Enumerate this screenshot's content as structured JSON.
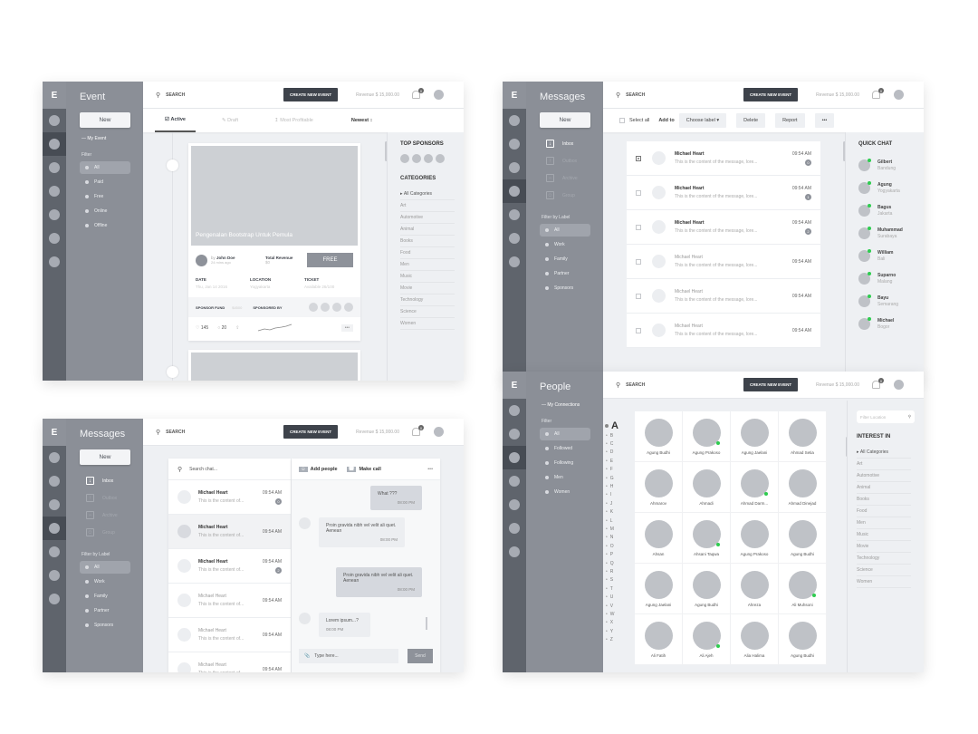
{
  "common": {
    "logo": "E",
    "search_label": "SEARCH",
    "create_button": "CREATE NEW EVENT",
    "revenue": "Revenue  $ 15,000.00",
    "notification_count": "0",
    "new_button": "New"
  },
  "event": {
    "title": "Event",
    "my_event": "My Event",
    "filter_label": "Filter",
    "filters": [
      "All",
      "Paid",
      "Free",
      "Online",
      "Offline"
    ],
    "tabs": [
      "Active",
      "Draft",
      "Most Profitable"
    ],
    "sort": "Newest",
    "card": {
      "title": "Pengenalan Bootstrap Untuk Pemula",
      "by": "by",
      "author": "John Doe",
      "posted": "24 mins ago",
      "revenue_label": "Total Revenue",
      "revenue_value": "$0",
      "price_button": "FREE",
      "date_label": "DATE",
      "date_value": "Thu, Jan 14 2016",
      "location_label": "LOCATION",
      "location_value": "Yogyakarta",
      "ticket_label": "TICKET",
      "ticket_value": "Available 26/100",
      "sponsor_fund_label": "SPONSOR FUND",
      "sponsor_fund_value": "$4500",
      "sponsored_by_label": "SPONSORED BY",
      "likes": "145",
      "comments": "20",
      "more": "•••"
    },
    "top_sponsors_title": "TOP SPONSORS",
    "categories_title": "CATEGORIES",
    "categories": [
      "All Categories",
      "Art",
      "Automotive",
      "Animal",
      "Books",
      "Food",
      "Men",
      "Music",
      "Movie",
      "Technology",
      "Science",
      "Women"
    ]
  },
  "messages": {
    "title": "Messages",
    "nav": [
      "Inbox",
      "Outbox",
      "Archive",
      "Group"
    ],
    "filter_label": "Filter by Label",
    "labels": [
      "All",
      "Work",
      "Family",
      "Partner",
      "Sponsors"
    ],
    "select_all": "Select all",
    "add_to": "Add to",
    "choose_label": "Choose label",
    "delete": "Delete",
    "report": "Report",
    "more": "•••",
    "list": [
      {
        "name": "Michael Heart",
        "preview": "This is the content of the message, lore...",
        "time": "09:54 AM",
        "badge": "0",
        "checked": true
      },
      {
        "name": "Michael Heart",
        "preview": "This is the content of the message, lore...",
        "time": "09:54 AM",
        "badge": "1",
        "checked": false
      },
      {
        "name": "Michael Heart",
        "preview": "This is the content of the message, lore...",
        "time": "09:54 AM",
        "badge": "2",
        "checked": false
      },
      {
        "name": "Michael Heart",
        "preview": "This is the content of the message, lore...",
        "time": "09:54 AM",
        "badge": "",
        "checked": false
      },
      {
        "name": "Michael Heart",
        "preview": "This is the content of the message, lore...",
        "time": "09:54 AM",
        "badge": "",
        "checked": false
      },
      {
        "name": "Michael Heart",
        "preview": "This is the content of the message, lore...",
        "time": "09:54 AM",
        "badge": "",
        "checked": false
      }
    ],
    "quick_chat_title": "QUICK CHAT",
    "quick_chat": [
      {
        "name": "Gilbert",
        "city": "Bandung"
      },
      {
        "name": "Agung",
        "city": "Yogyakarta"
      },
      {
        "name": "Bagus",
        "city": "Jakarta"
      },
      {
        "name": "Muhammad",
        "city": "Surabaya"
      },
      {
        "name": "William",
        "city": "Bali"
      },
      {
        "name": "Suparno",
        "city": "Malang"
      },
      {
        "name": "Bayu",
        "city": "Semarang"
      },
      {
        "name": "Michael",
        "city": "Bogor"
      }
    ]
  },
  "chat": {
    "search_placeholder": "Search chat...",
    "add_people": "Add people",
    "make_call": "Make call",
    "more": "•••",
    "list": [
      {
        "name": "Michael Heart",
        "preview": "This is the content of...",
        "time": "09:54 AM",
        "badge": "0"
      },
      {
        "name": "Michael Heart",
        "preview": "This is the content of...",
        "time": "09:54 AM",
        "badge": ""
      },
      {
        "name": "Michael Heart",
        "preview": "This is the content of...",
        "time": "09:54 AM",
        "badge": "2"
      },
      {
        "name": "Michael Heart",
        "preview": "This is the content of...",
        "time": "09:54 AM",
        "badge": ""
      },
      {
        "name": "Michael Heart",
        "preview": "This is the content of...",
        "time": "09:54 AM",
        "badge": ""
      },
      {
        "name": "Michael Heart",
        "preview": "This is the content of...",
        "time": "09:54 AM",
        "badge": ""
      }
    ],
    "bubbles": [
      {
        "text": "What ???",
        "time": "08:00 PM",
        "side": "right"
      },
      {
        "text": "Proin gravida nibh vel velit ali quet. Aenean",
        "time": "08:00 PM",
        "side": "left"
      },
      {
        "text": "Proin gravida nibh vel velit ali quet. Aenean",
        "time": "08:00 PM",
        "side": "right"
      },
      {
        "text": "Lorem ipsum...?",
        "time": "08:00 PM",
        "side": "left"
      }
    ],
    "input_placeholder": "Type here...",
    "send": "Send"
  },
  "people": {
    "title": "People",
    "my_connections": "My Connections",
    "filter_label": "Filter",
    "filters": [
      "All",
      "Followed",
      "Following",
      "Men",
      "Women"
    ],
    "current_letter": "A",
    "letters": [
      "B",
      "C",
      "D",
      "E",
      "F",
      "G",
      "H",
      "I",
      "J",
      "K",
      "L",
      "M",
      "N",
      "O",
      "P",
      "Q",
      "R",
      "S",
      "T",
      "U",
      "V",
      "W",
      "X",
      "Y",
      "Z"
    ],
    "grid": [
      {
        "name": "Agung Budhi",
        "online": false
      },
      {
        "name": "Agung Prakoso",
        "online": true
      },
      {
        "name": "Agung Jaelani",
        "online": false
      },
      {
        "name": "Ahmad Setia",
        "online": false
      },
      {
        "name": "Ahmarov",
        "online": false
      },
      {
        "name": "Ahmadi",
        "online": false
      },
      {
        "name": "Ahmad Darm...",
        "online": true
      },
      {
        "name": "Ahmad Dinejad",
        "online": false
      },
      {
        "name": "Ahsan",
        "online": false
      },
      {
        "name": "Ahsani Taqwa",
        "online": true
      },
      {
        "name": "Agung Prakoso",
        "online": false
      },
      {
        "name": "Agung Budhi",
        "online": false
      },
      {
        "name": "Agung Jaelani",
        "online": false
      },
      {
        "name": "Agung Budhi",
        "online": false
      },
      {
        "name": "Ahreza",
        "online": false
      },
      {
        "name": "Ali Muhsoni",
        "online": true
      },
      {
        "name": "Ali Fatih",
        "online": false
      },
      {
        "name": "Ali Ajeh",
        "online": true
      },
      {
        "name": "Alia Halima",
        "online": false
      },
      {
        "name": "Agung Budhi",
        "online": false
      }
    ],
    "filter_location_placeholder": "Filter Location",
    "interest_title": "INTEREST IN",
    "categories": [
      "All Categories",
      "Art",
      "Automotive",
      "Animal",
      "Books",
      "Food",
      "Men",
      "Music",
      "Movie",
      "Technology",
      "Science",
      "Women"
    ]
  }
}
